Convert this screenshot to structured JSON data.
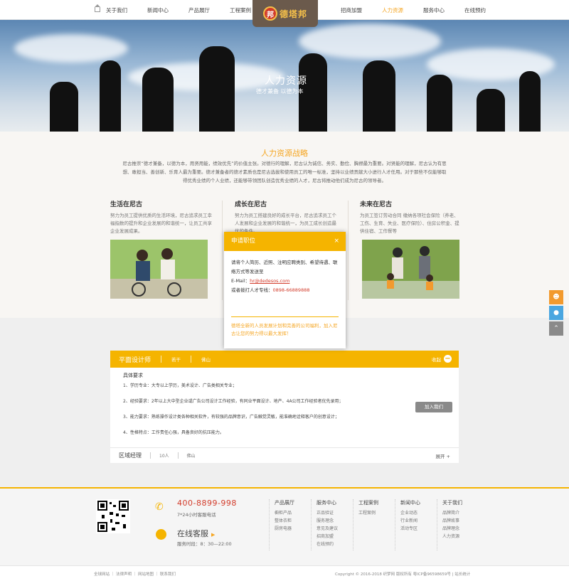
{
  "nav": {
    "left": [
      "关于我们",
      "新闻中心",
      "产品展厅",
      "工程案例"
    ],
    "right": [
      "招商加盟",
      "人力资源",
      "服务中心",
      "在线预约"
    ],
    "active": "人力资源"
  },
  "logo": {
    "mark": "邦",
    "text": "德塔邦"
  },
  "banner": {
    "title": "人力资源",
    "subtitle": "德才兼备 以德为本"
  },
  "strategy": {
    "title": "人力资源战略",
    "intro": "尼古推崇“德才兼备，以德为本，用贤用能，绩效优先”的价值主张。对德行的理解，尼古认为诚信、务实、勤俭、胸襟最为重要。对贤能的理解，尼古认为有思想、敢担当、善创新、乐育人最为重要。德才兼备者的德才素质也是尼古选拔和使用员工的唯一标准，坚持以业绩贡献大小进行人才任用。对于那些不仅能够取得优秀业绩的个人业绩，还能够带领团队创造优秀业绩的人才，尼古将推动他们成为尼古的领导者。",
    "columns": [
      {
        "title": "生活在尼古",
        "text": "努力为员工提供优质的生活环境，尼古追求员工幸福指数的提升和企业发展的和谐统一，让员工共享企业发展成果。"
      },
      {
        "title": "成长在尼古",
        "text": "努力为员工搭建良好的成长平台，尼古追求员工个人发展和企业发展的和谐统一，为员工成长创造最优的条件。"
      },
      {
        "title": "未来在尼古",
        "text": "为员工签订劳动合同 缴纳各项社会保险（养老、工伤、生育、失业、医疗保险）、住房公积金、提供住宿、工作餐等"
      }
    ]
  },
  "modal": {
    "title": "申请职位",
    "close": "×",
    "line1": "请将个人简历、近照、注明应聘类别、希望待遇、联络方式等发送至",
    "email_label": "E-Mail：",
    "email": "hr@dedesos.com",
    "tel_label": "或者拨打人才专线：",
    "tel": "0898-66889888",
    "footer": "德塔全新的人员发展计划和完善的公司福利，加入尼古让您的努力得以最大发挥！"
  },
  "job": {
    "title": "平面设计师",
    "count": "若干",
    "location": "佛山",
    "more": "收起",
    "req_title": "具体要求",
    "reqs": [
      "1、学历专业：大专以上学历，美术设计、广告类相关专业；",
      "2、经验要求：2年以上大中型企业或广告公司设计工作经验，有同业平面设计、地产、4A公司工作经验者优先录用；",
      "3、能力要求：熟练操作设计类各种相关软件，有较强的品牌意识，广告触觉灵敏，能准确地诠释客户的创意设计；",
      "4、性格特点：工作责任心强，具备良好的抗压能力。"
    ],
    "join": "加入我们"
  },
  "job2": {
    "title": "区域经理",
    "count": "10人",
    "location": "佛山",
    "more": "展开"
  },
  "footer": {
    "phone": "400-8899-998",
    "phone_sub": "7*24小时客服电话",
    "service": "在线客服",
    "service_sub": "服务时段：8：30—22:00",
    "columns": [
      {
        "title": "产品展厅",
        "items": [
          "橱柜产品",
          "整体衣柜",
          "厨房电器"
        ]
      },
      {
        "title": "服务中心",
        "items": [
          "正品验证",
          "服务理念",
          "意见及建议",
          "招商加盟",
          "在线预约"
        ]
      },
      {
        "title": "工程案例",
        "items": [
          "工程案例"
        ]
      },
      {
        "title": "新闻中心",
        "items": [
          "企业动态",
          "行业新闻",
          "活动专区"
        ]
      },
      {
        "title": "关于我们",
        "items": [
          "品牌简介",
          "品牌故事",
          "品牌理念",
          "人力资源"
        ]
      }
    ],
    "bottom_left": "全球网站 ｜ 法律声明 ｜ 网站地图 ｜ 联系我们",
    "bottom_right": "Copyright © 2016-2018 织梦网 版权所有 粤ICP备96598659号 | 站长统计"
  },
  "colors": {
    "accent": "#f5b400",
    "highlight": "#f5a623",
    "red": "#d23b2a"
  }
}
